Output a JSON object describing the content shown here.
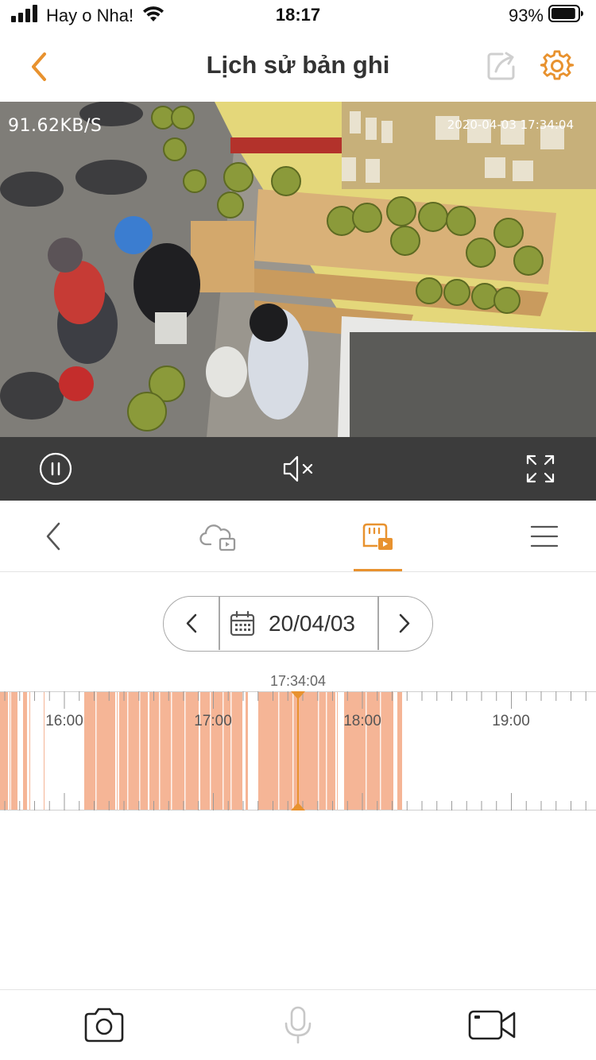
{
  "status_bar": {
    "carrier": "Hay o Nha!",
    "time": "18:17",
    "battery_percent": "93%",
    "battery_level": 0.93
  },
  "header": {
    "title": "Lịch sử bản ghi",
    "back_icon": "chevron-left-icon",
    "share_icon": "share-icon",
    "settings_icon": "gear-icon",
    "accent_color": "#e8922f"
  },
  "video": {
    "bitrate": "91.62KB/S",
    "timestamp": "2020-04-03 17:34:04"
  },
  "video_controls": {
    "pause_icon": "pause-icon",
    "mute_icon": "speaker-muted-icon",
    "fullscreen_icon": "fullscreen-icon"
  },
  "tabs": [
    {
      "icon": "chevron-left-icon"
    },
    {
      "icon": "cloud-playback-icon"
    },
    {
      "icon": "sd-card-playback-icon",
      "active": true
    },
    {
      "icon": "menu-icon"
    }
  ],
  "date_picker": {
    "date": "20/04/03"
  },
  "timeline": {
    "current_time": "17:34:04",
    "labels": [
      "16:00",
      "17:00",
      "18:00",
      "19:00"
    ],
    "recording_color": "#f5b596"
  },
  "bottom_bar": {
    "snapshot_icon": "camera-icon",
    "talk_icon": "microphone-icon",
    "record_icon": "video-camera-icon"
  }
}
